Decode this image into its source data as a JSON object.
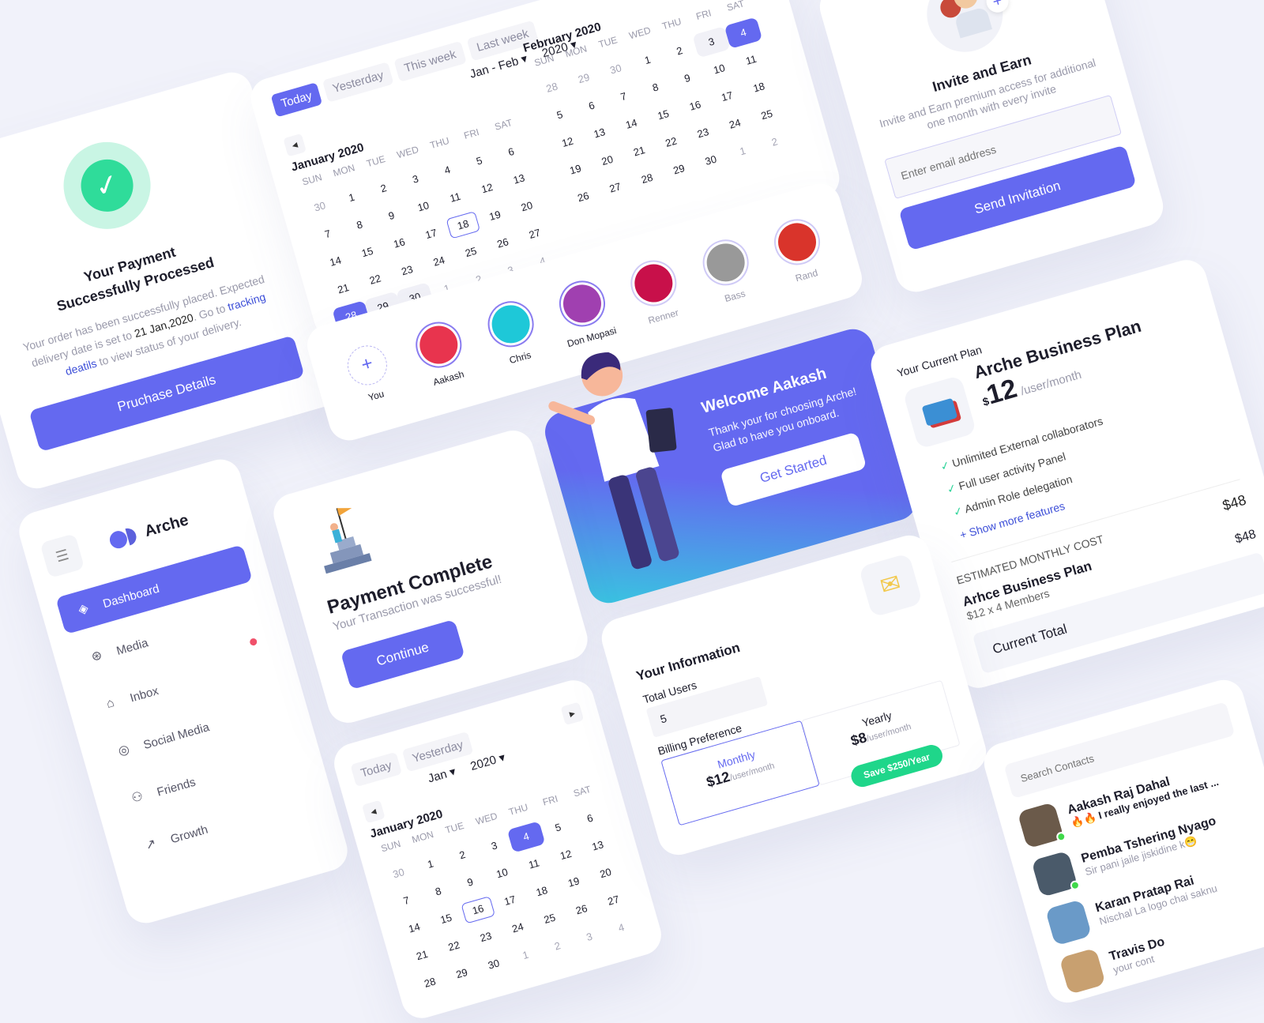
{
  "colors": {
    "accent": "#6469f0",
    "success": "#35e0a1",
    "save_badge": "#1fd68a",
    "background": "#f1f2fa"
  },
  "payment_processed": {
    "icon": "check-circle-icon",
    "title_line1": "Your Payment",
    "title_line2": "Successfully Processed",
    "body_pre": "Your order has been successfully placed. Expected delivery date is set to ",
    "date": "21 Jan,2020",
    "body_mid": ". Go to ",
    "link": "tracking deatils",
    "body_post": " to view status of your delivery.",
    "button": "Pruchase Details"
  },
  "range_calendar": {
    "tabs": [
      {
        "label": "Today",
        "active": true
      },
      {
        "label": "Yesterday"
      },
      {
        "label": "This week"
      },
      {
        "label": "Last week"
      }
    ],
    "month_select": "Jan - Feb",
    "year_select": "2020",
    "months": [
      {
        "title": "January 2020",
        "weekdays": [
          "SUN",
          "MON",
          "TUE",
          "WED",
          "THU",
          "FRI",
          "SAT"
        ],
        "days": [
          [
            "30",
            "dim"
          ],
          [
            "1"
          ],
          [
            "2"
          ],
          [
            "3"
          ],
          [
            "4"
          ],
          [
            "5"
          ],
          [
            "6"
          ],
          [
            "7"
          ],
          [
            "8"
          ],
          [
            "9"
          ],
          [
            "10"
          ],
          [
            "11"
          ],
          [
            "12"
          ],
          [
            "13"
          ],
          [
            "14"
          ],
          [
            "15"
          ],
          [
            "16"
          ],
          [
            "17"
          ],
          [
            "18",
            "out"
          ],
          [
            "19"
          ],
          [
            "20"
          ],
          [
            "21"
          ],
          [
            "22"
          ],
          [
            "23"
          ],
          [
            "24"
          ],
          [
            "25"
          ],
          [
            "26"
          ],
          [
            "27"
          ],
          [
            "28",
            "sel"
          ],
          [
            "29",
            "rng"
          ],
          [
            "30",
            "rng"
          ],
          [
            "1",
            "dim"
          ],
          [
            "2",
            "dim"
          ],
          [
            "3",
            "dim"
          ],
          [
            "4",
            "dim"
          ]
        ]
      },
      {
        "title": "February 2020",
        "weekdays": [
          "SUN",
          "MON",
          "TUE",
          "WED",
          "THU",
          "FRI",
          "SAT"
        ],
        "days": [
          [
            "28",
            "dim"
          ],
          [
            "29",
            "dim"
          ],
          [
            "30",
            "dim"
          ],
          [
            "1"
          ],
          [
            "2"
          ],
          [
            "3",
            "rng"
          ],
          [
            "4",
            "sel"
          ],
          [
            "5"
          ],
          [
            "6"
          ],
          [
            "7"
          ],
          [
            "8"
          ],
          [
            "9"
          ],
          [
            "10"
          ],
          [
            "11"
          ],
          [
            "12"
          ],
          [
            "13"
          ],
          [
            "14"
          ],
          [
            "15"
          ],
          [
            "16"
          ],
          [
            "17"
          ],
          [
            "18"
          ],
          [
            "19"
          ],
          [
            "20"
          ],
          [
            "21"
          ],
          [
            "22"
          ],
          [
            "23"
          ],
          [
            "24"
          ],
          [
            "25"
          ],
          [
            "26"
          ],
          [
            "27"
          ],
          [
            "28"
          ],
          [
            "29"
          ],
          [
            "30"
          ],
          [
            "1",
            "dim"
          ],
          [
            "2",
            "dim"
          ]
        ]
      }
    ]
  },
  "invite": {
    "title": "Invite and Earn",
    "subtitle": "Invite and Earn premium access for additional one month with every invite",
    "email_placeholder": "Enter email address",
    "button": "Send Invitation"
  },
  "stories": [
    {
      "name": "You",
      "type": "add"
    },
    {
      "name": "Aakash",
      "color": "#e8344e"
    },
    {
      "name": "Chris",
      "color": "#1ec8d8"
    },
    {
      "name": "Don Mopasi",
      "color": "#a040b0"
    },
    {
      "name": "Renner",
      "color": "#c8104a",
      "seen": true
    },
    {
      "name": "Bass",
      "color": "#999999",
      "seen": true
    },
    {
      "name": "Rand",
      "color": "#d9342b",
      "seen": true
    }
  ],
  "welcome": {
    "title": "Welcome Aakash",
    "body": "Thank your for choosing Arche! Glad to have you onboard.",
    "button": "Get Started"
  },
  "plan": {
    "label": "Your Current Plan",
    "name": "Arche Business Plan",
    "currency": "$",
    "price": "12",
    "period": "/user/month",
    "features": [
      "Unlimited External collaborators",
      "Full user activity Panel",
      "Admin Role delegation"
    ],
    "show_more": "Show more features",
    "estimate_label": "ESTIMATED MONTHLY COST",
    "estimate_value": "$48",
    "line_name": "Arhce Business Plan",
    "line_detail": "$12 x 4 Members",
    "line_value": "$48",
    "total_label": "Current Total"
  },
  "sidebar": {
    "brand": "Arche",
    "items": [
      {
        "label": "Dashboard",
        "icon": "layers-icon",
        "active": true
      },
      {
        "label": "Media",
        "icon": "lifebuoy-icon"
      },
      {
        "label": "Inbox",
        "icon": "inbox-icon",
        "badge": true
      },
      {
        "label": "Social Media",
        "icon": "instagram-icon"
      },
      {
        "label": "Friends",
        "icon": "users-icon"
      },
      {
        "label": "Growth",
        "icon": "trending-up-icon"
      }
    ]
  },
  "payment_complete": {
    "title": "Payment Complete",
    "subtitle": "Your Transaction was successful!",
    "button": "Continue"
  },
  "single_calendar": {
    "tabs": [
      {
        "label": "Today"
      },
      {
        "label": "Yesterday"
      }
    ],
    "month_select": "Jan",
    "year_select": "2020",
    "month": {
      "title": "January 2020",
      "weekdays": [
        "SUN",
        "MON",
        "TUE",
        "WED",
        "THU",
        "FRI",
        "SAT"
      ],
      "days": [
        [
          "30",
          "dim"
        ],
        [
          "1"
        ],
        [
          "2"
        ],
        [
          "3"
        ],
        [
          "4",
          "sel"
        ],
        [
          "5"
        ],
        [
          "6"
        ],
        [
          "7"
        ],
        [
          "8"
        ],
        [
          "9"
        ],
        [
          "10"
        ],
        [
          "11"
        ],
        [
          "12"
        ],
        [
          "13"
        ],
        [
          "14"
        ],
        [
          "15"
        ],
        [
          "16",
          "out"
        ],
        [
          "17"
        ],
        [
          "18"
        ],
        [
          "19"
        ],
        [
          "20"
        ],
        [
          "21"
        ],
        [
          "22"
        ],
        [
          "23"
        ],
        [
          "24"
        ],
        [
          "25"
        ],
        [
          "26"
        ],
        [
          "27"
        ],
        [
          "28"
        ],
        [
          "29"
        ],
        [
          "30"
        ],
        [
          "1",
          "dim"
        ],
        [
          "2",
          "dim"
        ],
        [
          "3",
          "dim"
        ],
        [
          "4",
          "dim"
        ]
      ]
    }
  },
  "your_info": {
    "title": "Your Information",
    "users_label": "Total Users",
    "users_value": "5",
    "billing_label": "Billing Preference",
    "monthly": {
      "label": "Monthly",
      "price": "$12",
      "period": "/user/month",
      "selected": true
    },
    "yearly": {
      "label": "Yearly",
      "price": "$8",
      "period": "/user/month",
      "badge": "Save $250/Year"
    }
  },
  "contacts": {
    "search_placeholder": "Search Contacts",
    "items": [
      {
        "name": "Aakash Raj Dahal",
        "message": "🔥🔥 I really enjoyed the last ...",
        "online": true,
        "unread": true,
        "color": "#6b5a4a"
      },
      {
        "name": "Pemba Tshering Nyago",
        "message": "Sir pani jaile jiskidine k😁",
        "online": true,
        "color": "#4a5a6a"
      },
      {
        "name": "Karan Pratap Rai",
        "message": "Nischal La logo chai saknu",
        "color": "#6a9ac8"
      },
      {
        "name": "Travis Do",
        "message": "your cont",
        "color": "#c8a070"
      }
    ]
  }
}
